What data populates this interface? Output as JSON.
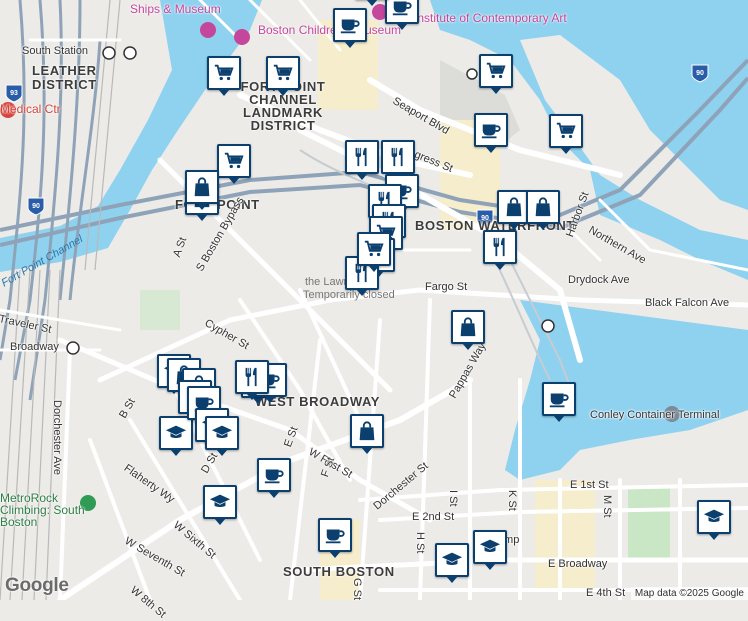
{
  "map": {
    "google_logo": "Google",
    "attribution": "Map data ©2025 Google",
    "colors": {
      "water": "#8fd2ef",
      "land": "#ecebe8",
      "road": "#ffffff",
      "highway": "#a9b6c4",
      "park": "#c9e6c5",
      "marker_border": "#0b3f6e"
    },
    "labels": [
      {
        "text": "Ships & Museum",
        "cls": "poi"
      },
      {
        "text": "Boston Children's Museum",
        "cls": "poi"
      },
      {
        "text": "Institute of Contemporary Art",
        "cls": "poi"
      },
      {
        "text": "South Station",
        "cls": "street"
      },
      {
        "text": "LEATHER",
        "cls": "area"
      },
      {
        "text": "DISTRICT",
        "cls": "area"
      },
      {
        "text": "FORT POINT CHANNEL LANDMARK DISTRICT",
        "cls": "area"
      },
      {
        "text": "Medical Ctr",
        "cls": "hosp"
      },
      {
        "text": "Seaport Blvd",
        "cls": "street"
      },
      {
        "text": "Congress St",
        "cls": "street"
      },
      {
        "text": "FORT POINT",
        "cls": "area"
      },
      {
        "text": "BOSTON WATERFRONT",
        "cls": "area"
      },
      {
        "text": "Northern Ave",
        "cls": "street"
      },
      {
        "text": "Harbor St",
        "cls": "street"
      },
      {
        "text": "Drydock Ave",
        "cls": "street"
      },
      {
        "text": "Fargo St",
        "cls": "street"
      },
      {
        "text": "Black Falcon Ave",
        "cls": "street"
      },
      {
        "text": "the Lawn on D",
        "cls": "grey"
      },
      {
        "text": "Temporarily closed",
        "cls": "grey"
      },
      {
        "text": "S Boston Bypass",
        "cls": "street"
      },
      {
        "text": "A St",
        "cls": "street"
      },
      {
        "text": "Cypher St",
        "cls": "street"
      },
      {
        "text": "Traveler St",
        "cls": "street"
      },
      {
        "text": "Broadway",
        "cls": "street"
      },
      {
        "text": "Fort Point Channel",
        "cls": "water"
      },
      {
        "text": "Dorchester Ave",
        "cls": "street"
      },
      {
        "text": "WEST BROADWAY",
        "cls": "area"
      },
      {
        "text": "W First St",
        "cls": "street"
      },
      {
        "text": "Pappas Way",
        "cls": "street"
      },
      {
        "text": "Conley Container Terminal",
        "cls": "street"
      },
      {
        "text": "E 1st St",
        "cls": "street"
      },
      {
        "text": "E 2nd St",
        "cls": "street"
      },
      {
        "text": "Dorchester St",
        "cls": "street"
      },
      {
        "text": "SOUTH BOSTON",
        "cls": "area"
      },
      {
        "text": "E Broadway",
        "cls": "street"
      },
      {
        "text": "E 4th St",
        "cls": "street"
      },
      {
        "text": "W Seventh St",
        "cls": "street"
      },
      {
        "text": "W Sixth St",
        "cls": "street"
      },
      {
        "text": "W 8th St",
        "cls": "street"
      },
      {
        "text": "Flaherty Wy",
        "cls": "street"
      },
      {
        "text": "MetroRock Climbing: South Boston",
        "cls": "green"
      },
      {
        "text": "D St",
        "cls": "street"
      },
      {
        "text": "E St",
        "cls": "street"
      },
      {
        "text": "F St",
        "cls": "street"
      },
      {
        "text": "B St",
        "cls": "street"
      },
      {
        "text": "K St",
        "cls": "street"
      },
      {
        "text": "M St",
        "cls": "street"
      },
      {
        "text": "I St",
        "cls": "street"
      },
      {
        "text": "H St",
        "cls": "street"
      },
      {
        "text": "G St",
        "cls": "street"
      },
      {
        "text": "Ramp",
        "cls": "street"
      }
    ],
    "markers": [
      {
        "type": "cafe",
        "name": "cafe-marker"
      },
      {
        "type": "cafe",
        "name": "cafe-marker"
      },
      {
        "type": "cafe",
        "name": "cafe-marker"
      },
      {
        "type": "shop",
        "name": "grocery-marker"
      },
      {
        "type": "shop",
        "name": "grocery-marker"
      },
      {
        "type": "shop",
        "name": "grocery-marker"
      },
      {
        "type": "cafe",
        "name": "cafe-marker"
      },
      {
        "type": "shop",
        "name": "grocery-marker"
      },
      {
        "type": "food",
        "name": "restaurant-marker"
      },
      {
        "type": "food",
        "name": "restaurant-marker"
      },
      {
        "type": "shop",
        "name": "grocery-marker"
      },
      {
        "type": "bag",
        "name": "shopping-marker"
      },
      {
        "type": "bag",
        "name": "shopping-marker"
      },
      {
        "type": "cafe",
        "name": "cafe-marker"
      },
      {
        "type": "food",
        "name": "restaurant-marker"
      },
      {
        "type": "food",
        "name": "restaurant-marker"
      },
      {
        "type": "shop",
        "name": "grocery-marker"
      },
      {
        "type": "food",
        "name": "restaurant-marker"
      },
      {
        "type": "bag",
        "name": "shopping-marker"
      },
      {
        "type": "bag",
        "name": "shopping-marker"
      },
      {
        "type": "food",
        "name": "restaurant-marker"
      },
      {
        "type": "bag",
        "name": "shopping-marker"
      },
      {
        "type": "cafe",
        "name": "cafe-marker"
      },
      {
        "type": "food",
        "name": "restaurant-marker"
      },
      {
        "type": "shop",
        "name": "grocery-marker"
      },
      {
        "type": "bag",
        "name": "shopping-marker"
      },
      {
        "type": "food",
        "name": "restaurant-marker"
      },
      {
        "type": "cafe",
        "name": "cafe-marker"
      },
      {
        "type": "school",
        "name": "school-marker"
      },
      {
        "type": "school",
        "name": "school-marker"
      },
      {
        "type": "food",
        "name": "restaurant-marker"
      },
      {
        "type": "bag",
        "name": "shopping-marker"
      },
      {
        "type": "bag",
        "name": "shopping-marker"
      },
      {
        "type": "bag",
        "name": "shopping-marker"
      },
      {
        "type": "cafe",
        "name": "cafe-marker"
      },
      {
        "type": "school",
        "name": "school-marker"
      },
      {
        "type": "school",
        "name": "school-marker"
      },
      {
        "type": "cafe",
        "name": "cafe-marker"
      },
      {
        "type": "cafe",
        "name": "cafe-marker"
      },
      {
        "type": "school",
        "name": "school-marker"
      },
      {
        "type": "school",
        "name": "school-marker"
      },
      {
        "type": "school",
        "name": "school-marker"
      },
      {
        "type": "school",
        "name": "school-marker"
      }
    ]
  }
}
